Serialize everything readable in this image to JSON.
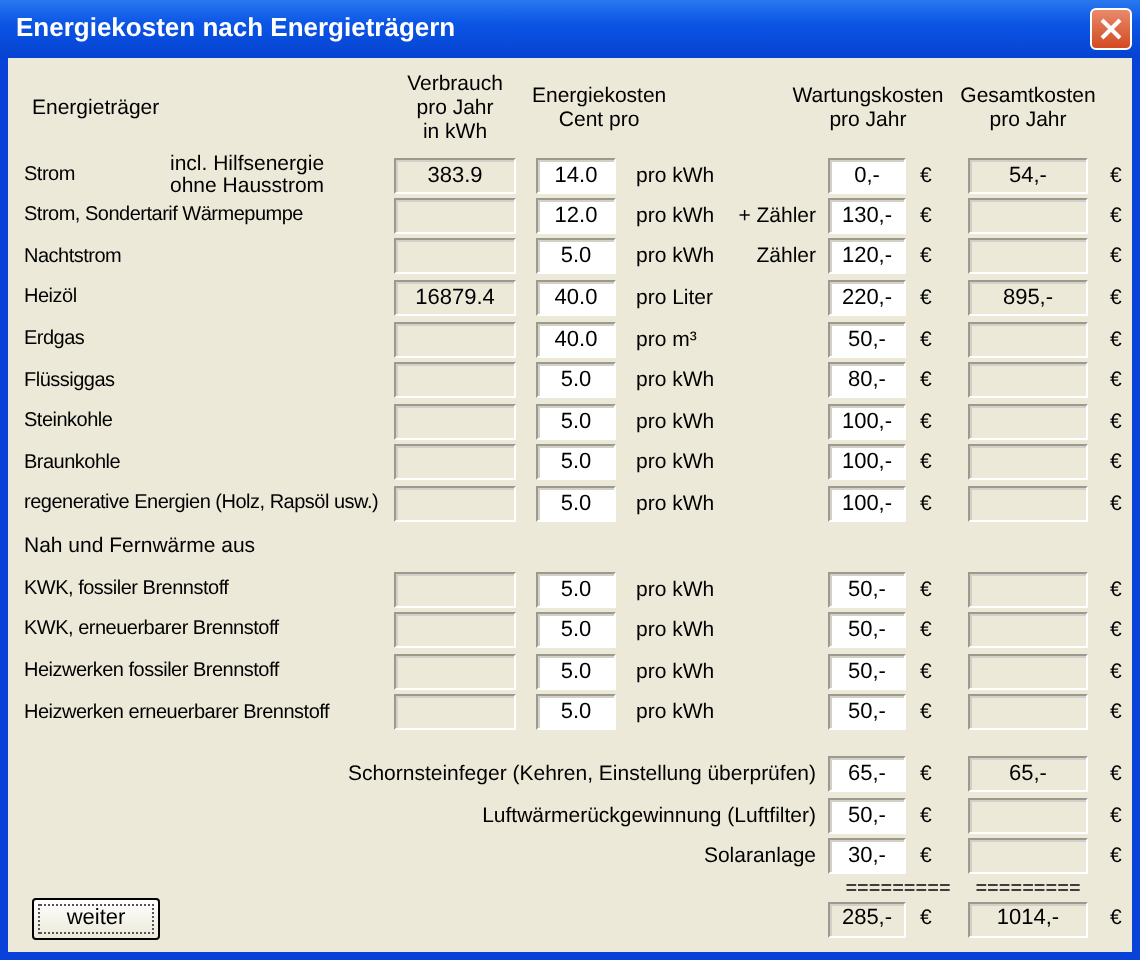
{
  "window": {
    "title": "Energiekosten nach Energieträgern"
  },
  "header": {
    "carrier": "Energieträger",
    "consumption": "Verbrauch\npro Jahr\nin kWh",
    "cost": "Energiekosten\nCent pro",
    "maintenance": "Wartungskosten\npro Jahr",
    "total": "Gesamtkosten\npro Jahr"
  },
  "rows": [
    {
      "kind": "carrier",
      "label": "Strom",
      "note": "incl. Hilfsenergie\nohne Hausstrom",
      "consumption": "383.9",
      "cost": "14.0",
      "unit": "pro kWh",
      "maintenance": "0,-",
      "maintenance_currency": "€",
      "total": "54,-",
      "total_currency": "€"
    },
    {
      "kind": "carrier",
      "label": "Strom, Sondertarif Wärmepumpe",
      "cost": "12.0",
      "unit": "pro kWh",
      "maintenance_prefix": "+ Zähler",
      "maintenance": "130,-",
      "maintenance_currency": "€",
      "total_currency": "€"
    },
    {
      "kind": "carrier",
      "label": "Nachtstrom",
      "cost": "5.0",
      "unit": "pro kWh",
      "maintenance_prefix": "Zähler",
      "maintenance": "120,-",
      "maintenance_currency": "€",
      "total_currency": "€"
    },
    {
      "kind": "carrier",
      "label": "Heizöl",
      "consumption": "16879.4",
      "cost": "40.0",
      "unit": "pro Liter",
      "maintenance": "220,-",
      "maintenance_currency": "€",
      "total": "895,-",
      "total_currency": "€"
    },
    {
      "kind": "carrier",
      "label": "Erdgas",
      "cost": "40.0",
      "unit": "pro m³",
      "maintenance": "50,-",
      "maintenance_currency": "€",
      "total_currency": "€"
    },
    {
      "kind": "carrier",
      "label": "Flüssiggas",
      "cost": "5.0",
      "unit": "pro kWh",
      "maintenance": "80,-",
      "maintenance_currency": "€",
      "total_currency": "€"
    },
    {
      "kind": "carrier",
      "label": "Steinkohle",
      "cost": "5.0",
      "unit": "pro kWh",
      "maintenance": "100,-",
      "maintenance_currency": "€",
      "total_currency": "€"
    },
    {
      "kind": "carrier",
      "label": "Braunkohle",
      "cost": "5.0",
      "unit": "pro kWh",
      "maintenance": "100,-",
      "maintenance_currency": "€",
      "total_currency": "€"
    },
    {
      "kind": "carrier",
      "label": "regenerative Energien (Holz, Rapsöl usw.)",
      "cost": "5.0",
      "unit": "pro kWh",
      "maintenance": "100,-",
      "maintenance_currency": "€",
      "total_currency": "€"
    },
    {
      "kind": "heading",
      "label": "Nah und Fernwärme aus"
    },
    {
      "kind": "carrier",
      "label": "KWK, fossiler Brennstoff",
      "cost": "5.0",
      "unit": "pro kWh",
      "maintenance": "50,-",
      "maintenance_currency": "€",
      "total_currency": "€"
    },
    {
      "kind": "carrier",
      "label": "KWK, erneuerbarer Brennstoff",
      "cost": "5.0",
      "unit": "pro kWh",
      "maintenance": "50,-",
      "maintenance_currency": "€",
      "total_currency": "€"
    },
    {
      "kind": "carrier",
      "label": "Heizwerken fossiler Brennstoff",
      "cost": "5.0",
      "unit": "pro kWh",
      "maintenance": "50,-",
      "maintenance_currency": "€",
      "total_currency": "€"
    },
    {
      "kind": "carrier",
      "label": "Heizwerken erneuerbarer Brennstoff",
      "cost": "5.0",
      "unit": "pro kWh",
      "maintenance": "50,-",
      "maintenance_currency": "€",
      "total_currency": "€"
    }
  ],
  "extras": [
    {
      "label": "Schornsteinfeger (Kehren, Einstellung überprüfen)",
      "maintenance": "65,-",
      "maintenance_currency": "€",
      "total": "65,-",
      "total_currency": "€"
    },
    {
      "label": "Luftwärmerückgewinnung (Luftfilter)",
      "maintenance": "50,-",
      "maintenance_currency": "€",
      "total_currency": "€"
    },
    {
      "label": "Solaranlage",
      "maintenance": "30,-",
      "maintenance_currency": "€",
      "total_currency": "€"
    }
  ],
  "separators": [
    "=========",
    "========="
  ],
  "totals": {
    "maintenance": "285,-",
    "maintenance_currency": "€",
    "total": "1014,-",
    "total_currency": "€"
  },
  "button": {
    "label": "weiter"
  }
}
